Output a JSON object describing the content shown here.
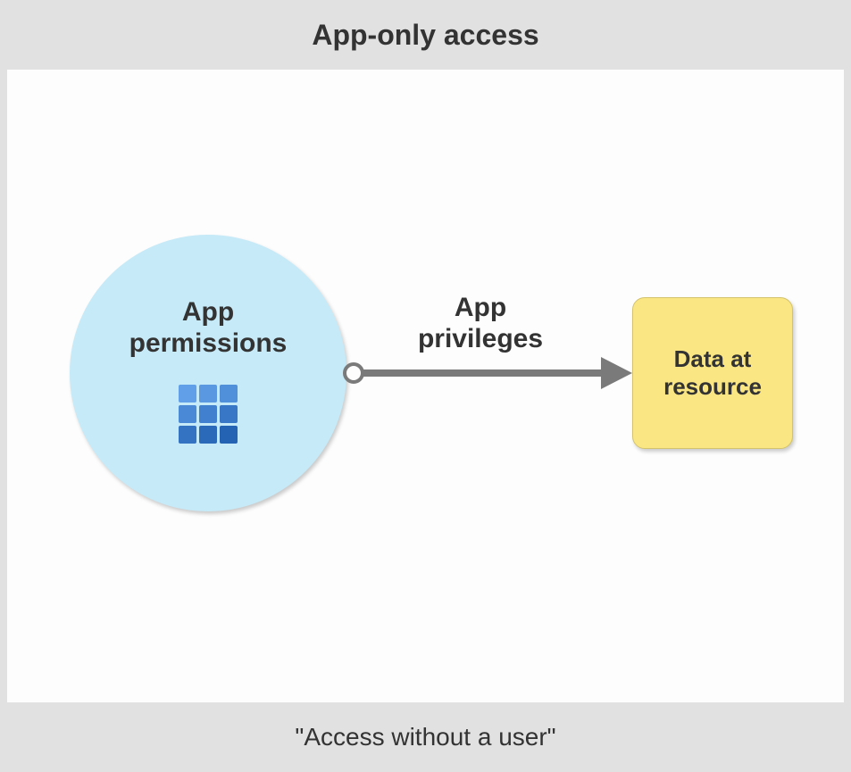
{
  "title": "App-only access",
  "footer": "\"Access without a user\"",
  "nodes": {
    "app": {
      "label_line1": "App",
      "label_line2": "permissions",
      "icon": "app-grid-icon"
    },
    "resource": {
      "label_line1": "Data at",
      "label_line2": "resource"
    }
  },
  "arrow": {
    "label_line1": "App",
    "label_line2": "privileges"
  },
  "colors": {
    "circle_fill": "#c6eaf8",
    "resource_fill": "#fae784",
    "arrow": "#7a7a7a",
    "background": "#e1e1e1"
  }
}
